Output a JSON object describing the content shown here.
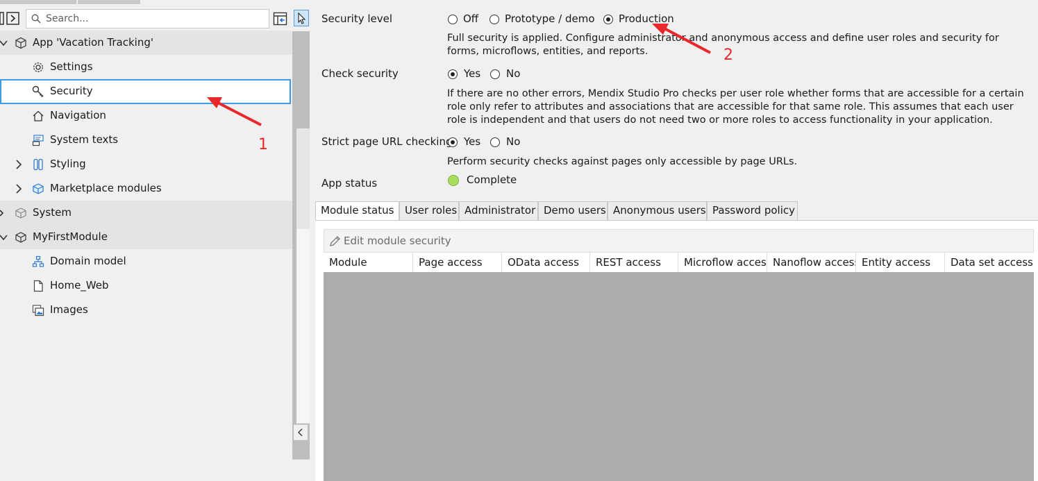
{
  "explorer": {
    "search_placeholder": "Search...",
    "tree": {
      "app_label": "App 'Vacation Tracking'",
      "app_items": [
        "Settings",
        "Security",
        "Navigation",
        "System texts",
        "Styling",
        "Marketplace modules"
      ],
      "system_label": "System",
      "module_label": "MyFirstModule",
      "module_items": [
        "Domain model",
        "Home_Web",
        "Images"
      ]
    }
  },
  "security": {
    "security_level": {
      "label": "Security level",
      "options": [
        "Off",
        "Prototype / demo",
        "Production"
      ],
      "selected": "Production",
      "description": "Full security is applied. Configure administrator and anonymous access and define user roles and security for forms, microflows, entities, and reports."
    },
    "check_security": {
      "label": "Check security",
      "options": [
        "Yes",
        "No"
      ],
      "selected": "Yes",
      "description": "If there are no other errors, Mendix Studio Pro checks per user role whether forms that are accessible for a certain role only refer to attributes and associations that are accessible for that same role. This assumes that each user role is independent and that users do not need two or more roles to access functionality in your application."
    },
    "strict_page_url": {
      "label": "Strict page URL checking",
      "options": [
        "Yes",
        "No"
      ],
      "selected": "Yes",
      "description": "Perform security checks against pages only accessible by page URLs."
    },
    "app_status": {
      "label": "App status",
      "value": "Complete",
      "status_color": "#a8dc5e"
    },
    "tabs": [
      "Module status",
      "User roles",
      "Administrator",
      "Demo users",
      "Anonymous users",
      "Password policy"
    ],
    "active_tab": "Module status",
    "edit_button_label": "Edit module security",
    "grid_columns": [
      "Module",
      "Page access",
      "OData access",
      "REST access",
      "Microflow access",
      "Nanoflow access",
      "Entity access",
      "Data set access"
    ]
  },
  "annotations": {
    "marker_1": "1",
    "marker_2": "2",
    "color": "#e8282b"
  }
}
